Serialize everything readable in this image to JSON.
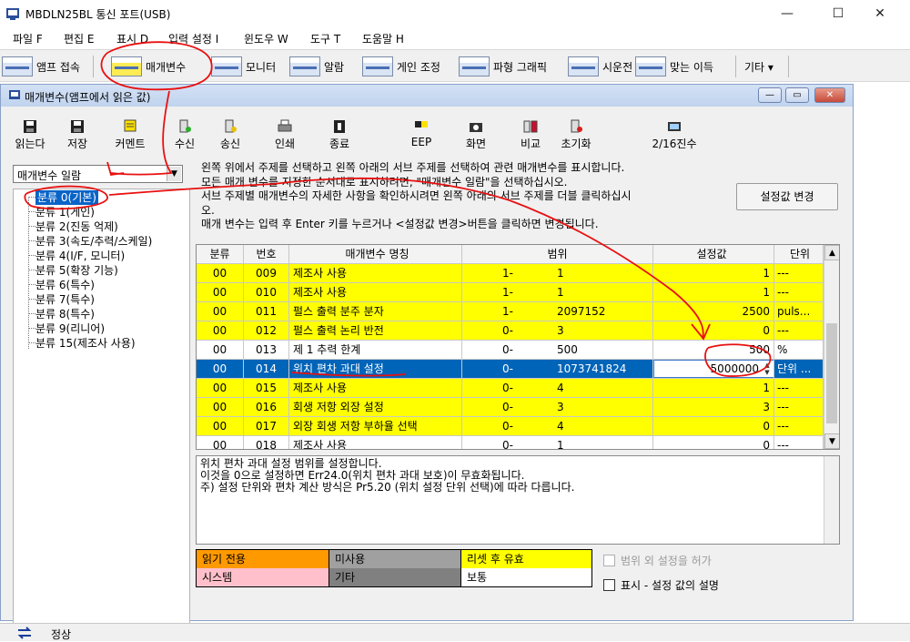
{
  "window": {
    "title": "MBDLN25BL 통신 포트(USB)",
    "min": "—",
    "max": "☐",
    "close": "✕"
  },
  "menu": [
    "파일 F",
    "편집 E",
    "표시 D",
    "입력 설정 I",
    "윈도우 W",
    "도구 T",
    "도움말 H"
  ],
  "toolbar": [
    {
      "label": "앰프 접속",
      "icon": "amp-connect-icon"
    },
    {
      "label": "매개변수",
      "icon": "parameter-icon"
    },
    {
      "label": "모니터",
      "icon": "monitor-icon"
    },
    {
      "label": "알람",
      "icon": "alarm-icon"
    },
    {
      "label": "게인 조정",
      "icon": "gain-tuning-icon"
    },
    {
      "label": "파형 그래픽",
      "icon": "waveform-graph-icon"
    },
    {
      "label": "시운전",
      "icon": "test-run-icon"
    },
    {
      "label": "맞는 이득",
      "icon": "fit-gain-icon"
    },
    {
      "label": "기타 ▾",
      "icon": ""
    }
  ],
  "child": {
    "title": "매개변수(앰프에서 읽은 값)",
    "buttons": {
      "min": "—",
      "max": "▭",
      "close": "✕"
    }
  },
  "child_toolbar": [
    "읽는다",
    "저장",
    "커멘트",
    "수신",
    "송신",
    "인쇄",
    "종료",
    "EEP",
    "화면",
    "비교",
    "초기화",
    "2/16진수"
  ],
  "category_select": "매개변수 일람",
  "tree": [
    "분류 0(기본)",
    "분류 1(게인)",
    "분류 2(진동 억제)",
    "분류 3(속도/추력/스케일)",
    "분류 4(I/F, 모니터)",
    "분류 5(확장 기능)",
    "분류 6(특수)",
    "분류 7(특수)",
    "분류 8(특수)",
    "분류 9(리니어)",
    "분류 15(제조사 사용)"
  ],
  "description": [
    "왼쪽 위에서 주제를 선택하고 왼쪽 아래의 서브 주제를 선택하여 관련 매개변수를 표시합니다.",
    "모든 매개 변수를 지정한 순서대로 표시하려면, \"매개변수 일람\"을 선택하십시오.",
    "서브 주제별 매개변수의 자세한 사항을 확인하시려면 왼쪽 아래의 서브 주제를 더블 클릭하십시",
    "오.",
    "매개 변수는 입력 후 Enter 키를 누르거나 <설정값 변경>버튼을 클릭하면 변경됩니다."
  ],
  "change_button": "설정값 변경",
  "grid": {
    "headers": [
      "분류",
      "번호",
      "매개변수 명칭",
      "범위",
      "설정값",
      "단위"
    ],
    "rows": [
      {
        "cat": "00",
        "no": "009",
        "name": "제조사 사용",
        "lo": "1-",
        "hi": "1",
        "val": "1",
        "unit": "---",
        "style": "yel"
      },
      {
        "cat": "00",
        "no": "010",
        "name": "제조사 사용",
        "lo": "1-",
        "hi": "1",
        "val": "1",
        "unit": "---",
        "style": "yel"
      },
      {
        "cat": "00",
        "no": "011",
        "name": "펄스 출력 분주 분자",
        "lo": "1-",
        "hi": "2097152",
        "val": "2500",
        "unit": "puls...",
        "style": "yel"
      },
      {
        "cat": "00",
        "no": "012",
        "name": "펄스 출력 논리 반전",
        "lo": "0-",
        "hi": "3",
        "val": "0",
        "unit": "---",
        "style": "yel"
      },
      {
        "cat": "00",
        "no": "013",
        "name": "제 1 추력 한계",
        "lo": "0-",
        "hi": "500",
        "val": "500",
        "unit": "%",
        "style": "wht"
      },
      {
        "cat": "00",
        "no": "014",
        "name": "위치 편차 과대 설정",
        "lo": "0-",
        "hi": "1073741824",
        "val": "5000000",
        "unit": "단위 ...",
        "style": "selr"
      },
      {
        "cat": "00",
        "no": "015",
        "name": "제조사 사용",
        "lo": "0-",
        "hi": "4",
        "val": "1",
        "unit": "---",
        "style": "yel"
      },
      {
        "cat": "00",
        "no": "016",
        "name": "회생 저항 외장 설정",
        "lo": "0-",
        "hi": "3",
        "val": "3",
        "unit": "---",
        "style": "yel"
      },
      {
        "cat": "00",
        "no": "017",
        "name": "외장 회생 저항 부하율 선택",
        "lo": "0-",
        "hi": "4",
        "val": "0",
        "unit": "---",
        "style": "yel"
      },
      {
        "cat": "00",
        "no": "018",
        "name": "제조사 사용",
        "lo": "0-",
        "hi": "1",
        "val": "0",
        "unit": "---",
        "style": "wht"
      }
    ]
  },
  "help": [
    "위치 편차 과대 설정 범위를 설정합니다.",
    "이것을 0으로 설정하면 Err24.0(위치 편차 과대 보호)이 무효화됩니다.",
    "주) 설정 단위와 편차 계산 방식은 Pr5.20 (위치 설정 단위 선택)에 따라 다릅니다."
  ],
  "legend": [
    {
      "label": "읽기 전용",
      "color": "#ff9900"
    },
    {
      "label": "미사용",
      "color": "#a0a0a0"
    },
    {
      "label": "리셋 후 유효",
      "color": "#ffff00"
    },
    {
      "label": "시스템",
      "color": "#ffc0cb"
    },
    {
      "label": "기타",
      "color": "#808080"
    },
    {
      "label": "보통",
      "color": "#ffffff"
    }
  ],
  "checks": {
    "out_of_range": "범위 외 설정을 허가",
    "show_desc": "표시 - 설정 값의 설명"
  },
  "status": "정상"
}
